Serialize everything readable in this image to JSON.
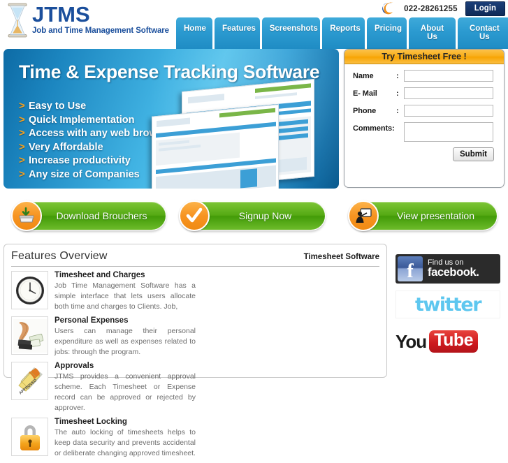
{
  "header": {
    "logo_title": "JTMS",
    "logo_sub": "Job and Time Management Software",
    "logo_icon": "hourglass-icon",
    "swoosh_icon": "swoosh-c-logo-icon",
    "phone": "022-28261255",
    "login_label": "Login",
    "nav": [
      {
        "label": "Home"
      },
      {
        "label": "Features"
      },
      {
        "label": "Screenshots"
      },
      {
        "label": "Reports"
      },
      {
        "label": "Pricing"
      },
      {
        "label": "About Us"
      },
      {
        "label": "Contact Us"
      }
    ]
  },
  "hero": {
    "title": "Time & Expense Tracking Software",
    "bullet_marker": ">",
    "bullets": [
      "Easy to Use",
      "Quick Implementation",
      "Access with any web browser",
      "Very Affordable",
      "Increase productivity",
      "Any size of Companies"
    ]
  },
  "form": {
    "heading": "Try Timesheet Free !",
    "fields": [
      {
        "label": "Name",
        "colon": ":",
        "value": "",
        "placeholder": ""
      },
      {
        "label": "E- Mail",
        "colon": ":",
        "value": "",
        "placeholder": ""
      },
      {
        "label": "Phone",
        "colon": ":",
        "value": "",
        "placeholder": ""
      }
    ],
    "comments_label": "Comments:",
    "comments_value": "",
    "submit_label": "Submit"
  },
  "cta_buttons": [
    {
      "label": "Download Brouchers",
      "icon": "download-box-icon"
    },
    {
      "label": "Signup Now",
      "icon": "checkmark-icon"
    },
    {
      "label": "View presentation",
      "icon": "presenter-icon"
    }
  ],
  "features": {
    "title": "Features  Overview",
    "side_title": "Timesheet Software",
    "items": [
      {
        "icon": "wall-clock-icon",
        "name": "Timesheet and Charges",
        "desc": "Job Time Management Software has a simple interface that lets users allocate both time and charges to Clients. Job,"
      },
      {
        "icon": "money-hand-icon",
        "name": "Personal Expenses",
        "desc": "Users can manage their personal expenditure as well as expenses related to jobs: through the program."
      },
      {
        "icon": "approved-stamp-icon",
        "name": "Approvals",
        "desc": "JTMS provides a convenient approval scheme. Each Timesheet or Expense record can be approved or rejected by approver."
      },
      {
        "icon": "padlock-icon",
        "name": "Timesheet Locking",
        "desc": "The auto locking of timesheets helps to keep data security and prevents accidental or deliberate changing approved timesheet."
      }
    ]
  },
  "social": {
    "facebook_line1": "Find us on",
    "facebook_line2": "facebook.",
    "facebook_glyph": "f",
    "twitter_label": "twitter",
    "youtube_you": "You",
    "youtube_tube": "Tube"
  },
  "colors": {
    "nav_blue": "#2b9ad0",
    "logo_blue": "#1b4f9c",
    "accent_orange": "#f6a11d",
    "cta_green": "#54a913",
    "form_header_gold": "#f9ad18",
    "youtube_red": "#cc181e",
    "twitter_blue": "#5ec7ef"
  }
}
